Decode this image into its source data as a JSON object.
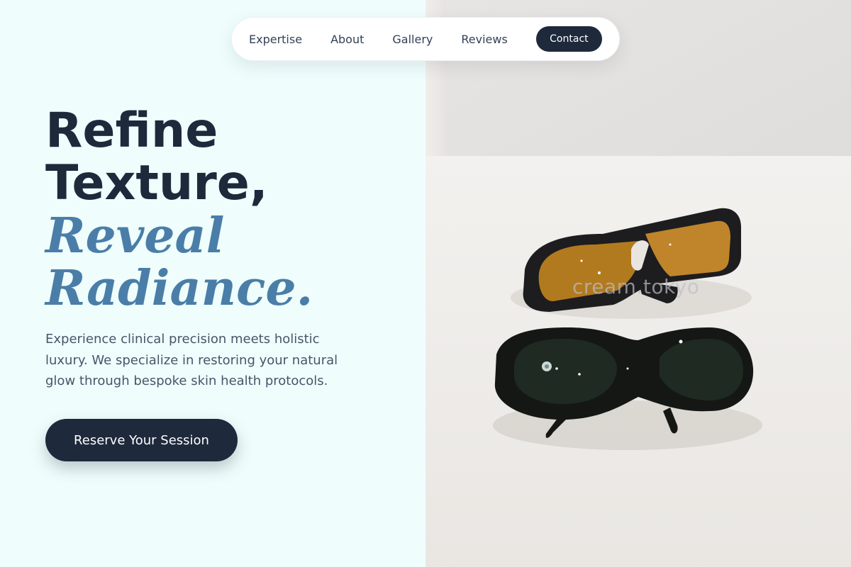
{
  "nav": {
    "links": [
      "Expertise",
      "About",
      "Gallery",
      "Reviews"
    ],
    "contact_label": "Contact"
  },
  "hero": {
    "headline_line1": "Refine",
    "headline_line2": "Texture,",
    "headline_accent1": "Reveal",
    "headline_accent2": "Radiance.",
    "subtext": "Experience clinical precision meets holistic luxury. We specialize in restoring your natural glow through bespoke skin health protocols.",
    "cta_label": "Reserve Your Session"
  },
  "image": {
    "watermark": "cream.tokyo",
    "subject": "two pairs of laser safety goggles"
  },
  "colors": {
    "primary": "#1e293b",
    "accent": "#4a7ea8",
    "background": "#effefd"
  }
}
